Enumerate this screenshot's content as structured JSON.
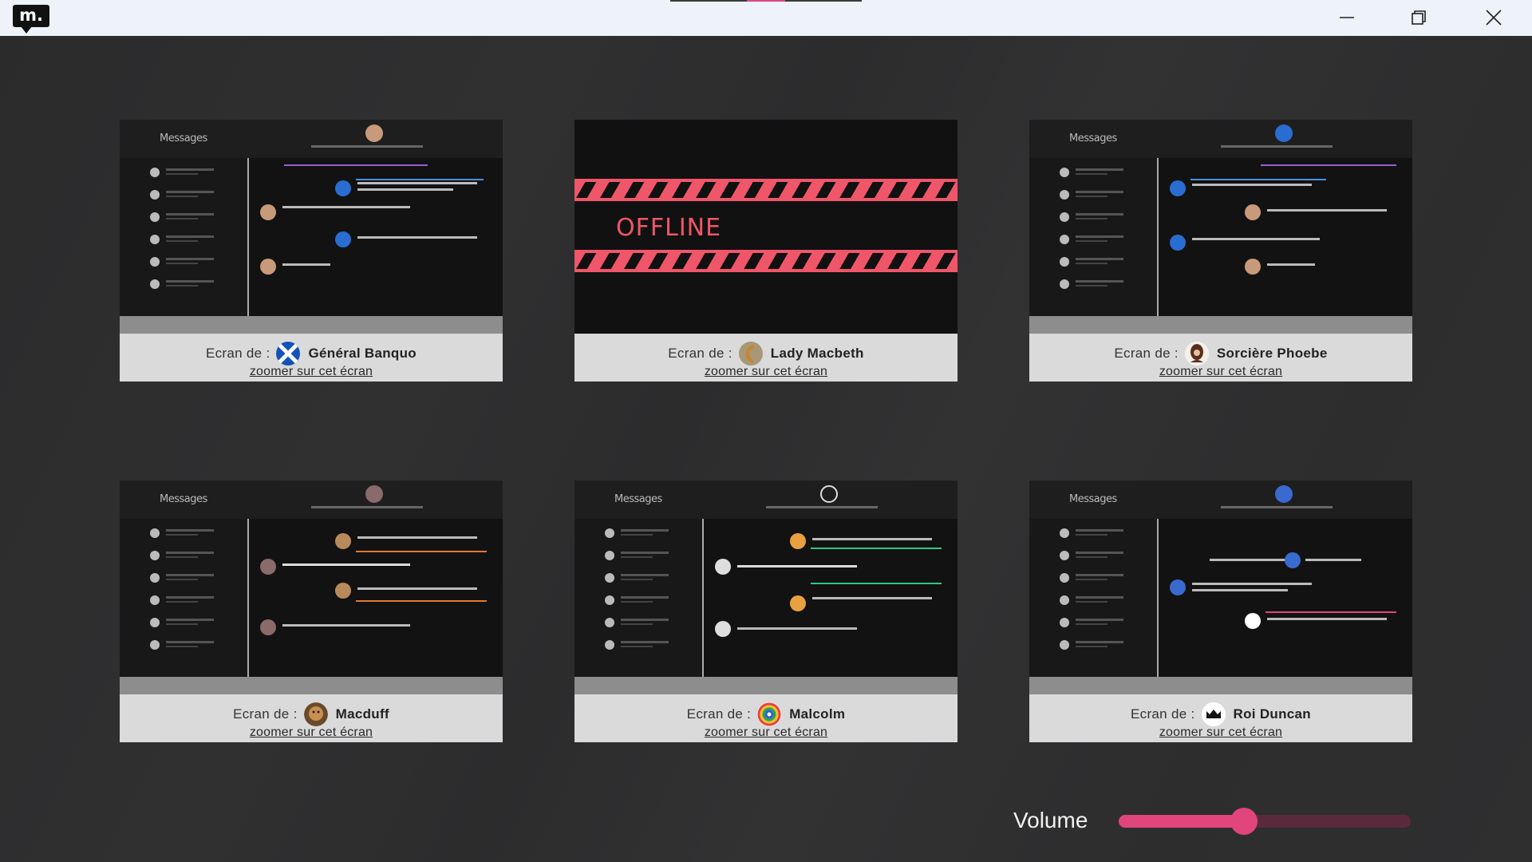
{
  "app": {
    "logo_text": "m."
  },
  "window": {
    "minimize_label": "",
    "restore_label": "",
    "close_label": ""
  },
  "tiles": [
    {
      "prefix": "Ecran de :",
      "name": "Général Banquo",
      "avatar_icon": "scotland-flag-icon",
      "zoom_label": "zoomer sur cet écran",
      "status": "live",
      "preview_title": "Messages"
    },
    {
      "prefix": "Ecran de :",
      "name": "Lady Macbeth",
      "avatar_icon": "lady-macbeth-avatar-icon",
      "zoom_label": "zoomer sur cet écran",
      "status": "offline",
      "offline_text": "OFFLINE"
    },
    {
      "prefix": "Ecran de :",
      "name": "Sorcière Phoebe",
      "avatar_icon": "witch-avatar-icon",
      "zoom_label": "zoomer sur cet écran",
      "status": "live",
      "preview_title": "Messages"
    },
    {
      "prefix": "Ecran de :",
      "name": "Macduff",
      "avatar_icon": "macduff-avatar-icon",
      "zoom_label": "zoomer sur cet écran",
      "status": "live",
      "preview_title": "Messages"
    },
    {
      "prefix": "Ecran de :",
      "name": "Malcolm",
      "avatar_icon": "peace-rainbow-icon",
      "zoom_label": "zoomer sur cet écran",
      "status": "live",
      "preview_title": "Messages"
    },
    {
      "prefix": "Ecran de :",
      "name": "Roi Duncan",
      "avatar_icon": "crown-icon",
      "zoom_label": "zoomer sur cet écran",
      "status": "live",
      "preview_title": "Messages"
    }
  ],
  "volume": {
    "label": "Volume",
    "value": 0.43
  },
  "colors": {
    "accent": "#e0457b",
    "offline_red": "#f0566a",
    "caption_bg": "#dadada",
    "titlebar_bg": "#eef2f9"
  }
}
